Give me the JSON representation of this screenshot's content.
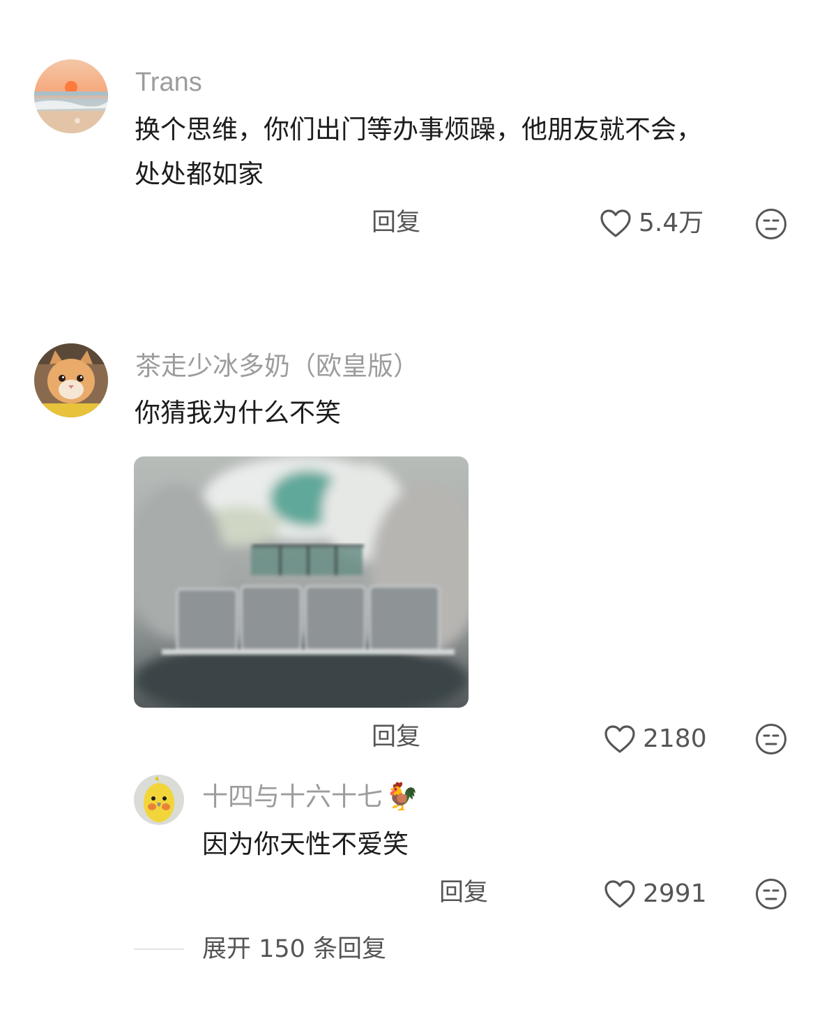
{
  "comments": [
    {
      "username": "Trans",
      "text_line1": "换个思维，你们出门等办事烦躁，他朋友就不会，",
      "text_line2": "处处都如家",
      "reply_label": "回复",
      "likes": "5.4万"
    },
    {
      "username": "茶走少冰多奶（欧皇版）",
      "text": "你猜我为什么不笑",
      "reply_label": "回复",
      "likes": "2180",
      "sub_reply": {
        "username": "十四与十六十七",
        "username_emoji": "🐓",
        "text": "因为你天性不爱笑",
        "reply_label": "回复",
        "likes": "2991"
      },
      "expand_label": "展开 150 条回复"
    }
  ],
  "colors": {
    "username": "#9c9c9c",
    "text": "#1c1c1c",
    "secondary": "#555555"
  },
  "icons": [
    "heart-outline-icon",
    "meh-face-icon",
    "rooster-emoji"
  ]
}
